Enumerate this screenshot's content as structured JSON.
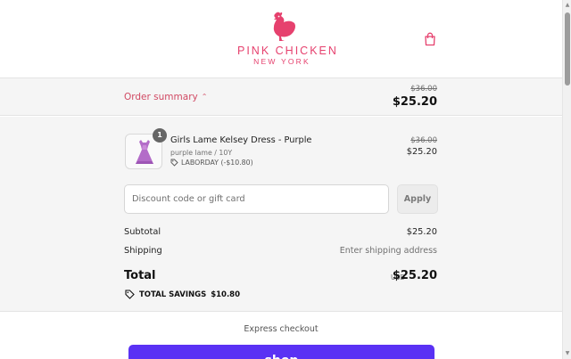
{
  "header": {
    "logo_line1": "PINK CHICKEN",
    "logo_line2": "NEW YORK",
    "cart_icon": "shopping-bag-icon"
  },
  "summary_bar": {
    "toggle_label": "Order summary",
    "toggle_icon": "chevron-up-icon",
    "original_price": "$36.00",
    "total_price": "$25.20"
  },
  "line_item": {
    "quantity": "1",
    "name": "Girls Lame Kelsey Dress - Purple",
    "variant": "purple lame / 10Y",
    "discount": "LABORDAY (-$10.80)",
    "original_price": "$36.00",
    "price": "$25.20"
  },
  "discount": {
    "placeholder": "Discount code or gift card",
    "apply_label": "Apply"
  },
  "totals": {
    "subtotal_label": "Subtotal",
    "subtotal_value": "$25.20",
    "shipping_label": "Shipping",
    "shipping_value": "Enter shipping address",
    "total_label": "Total",
    "currency": "USD",
    "total_value": "$25.20",
    "savings_label": "TOTAL SAVINGS",
    "savings_value": "$10.80"
  },
  "express": {
    "label": "Express checkout",
    "shop_button": "shop"
  },
  "colors": {
    "brand_pink": "#e6416e",
    "link_pink": "#d14a64",
    "shop_purple": "#5a31f4",
    "panel_bg": "#f5f5f5"
  }
}
